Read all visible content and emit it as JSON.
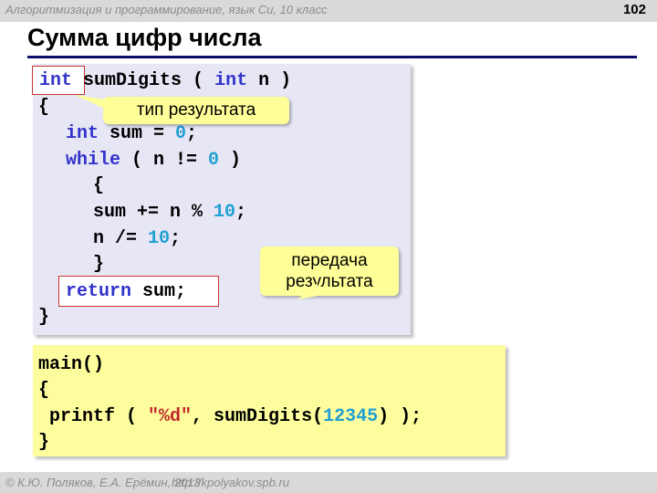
{
  "header": {
    "course": "Алгоритмизация и программирование, язык Си, 10 класс",
    "page_number": "102"
  },
  "title": "Сумма цифр числа",
  "function_code": {
    "l1_ret_type": "int",
    "l1_name": "sumDigits ( ",
    "l1_param_type": "int",
    "l1_param": " n )",
    "l2": "{",
    "l3_kw": "int",
    "l3_a": " sum = ",
    "l3_num": "0",
    "l3_b": ";",
    "l4_kw": "while",
    "l4_a": " ( n != ",
    "l4_num": "0",
    "l4_b": " )",
    "l5": "{",
    "l6_a": "sum += n % ",
    "l6_num": "10",
    "l6_b": ";",
    "l7_a": "n /= ",
    "l7_num": "10",
    "l7_b": ";",
    "l8": "}",
    "l9_kw": "return",
    "l9_a": " sum;",
    "l10": "}"
  },
  "main_code": {
    "l1": "main()",
    "l2": "{",
    "l3_a": " printf ( ",
    "l3_str": "\"%d\"",
    "l3_b": ", sumDigits(",
    "l3_num": "12345",
    "l3_c": ") );",
    "l4": "}"
  },
  "callouts": {
    "result_type": "тип результата",
    "return_line1": "передача",
    "return_line2": "результата"
  },
  "footer": {
    "copyright": "© К.Ю. Поляков, Е.А. Ерёмин, 2013",
    "url": "http://kpolyakov.spb.ru"
  },
  "colors": {
    "keyword": "#3333cc",
    "number": "#21a0d2",
    "string": "#c0262b",
    "highlight_border": "#cc3333",
    "code_bg": "#e6e6f5",
    "main_bg": "#fdfd9e",
    "callout_bg": "#ffff99",
    "title_rule": "#0d0d6b"
  }
}
